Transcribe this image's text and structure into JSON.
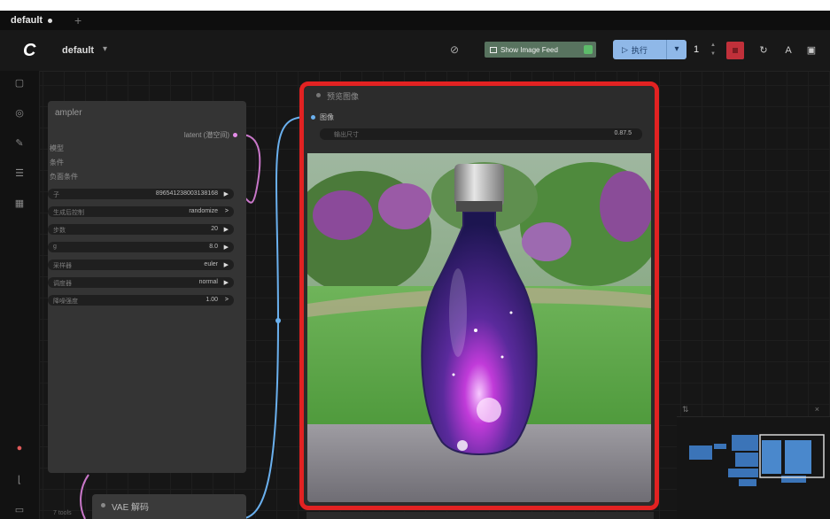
{
  "tabs": [
    {
      "label": "default"
    }
  ],
  "header": {
    "logo": "C",
    "workflow_name": "default",
    "workflow_caret": "▾",
    "feed_button_label": "Show Image Feed",
    "run_label": "执行",
    "queue_count": "1",
    "icons": [
      "link-icon",
      "reset-icon",
      "text-a-icon",
      "panel-icon"
    ]
  },
  "sidebar": {
    "icons": [
      "images-icon",
      "eye-icon",
      "edit-icon",
      "library-icon",
      "grid-icon",
      "color-wheel-icon",
      "chart-icon",
      "terminal-icon"
    ]
  },
  "sampler_node": {
    "title": "ampler",
    "output": "latent (潜空间)",
    "inputs": [
      "模型",
      "条件",
      "负面条件"
    ],
    "widgets": [
      {
        "label": "子",
        "value": "896541238003138168"
      },
      {
        "label": "生成后控制",
        "value": "randomize"
      },
      {
        "label": "步数",
        "value": "20"
      },
      {
        "label": "g",
        "value": "8.0"
      },
      {
        "label": "采样器",
        "value": "euler"
      },
      {
        "label": "调度器",
        "value": "normal"
      },
      {
        "label": "降噪强度",
        "value": "1.00"
      }
    ]
  },
  "vae_node": {
    "title": "VAE 解码",
    "small_label": "7 tools"
  },
  "preview_node": {
    "title": "预览图像",
    "input_label": "图像",
    "size_label": "输出尺寸",
    "size_value": "0.87.5"
  },
  "colors": {
    "highlight": "#e22222",
    "run_button": "#8fb8e8",
    "feed_button": "#58735f",
    "stop_button": "#c0303a",
    "link_blue": "#6ab0ee",
    "link_pink": "#e48de8"
  }
}
